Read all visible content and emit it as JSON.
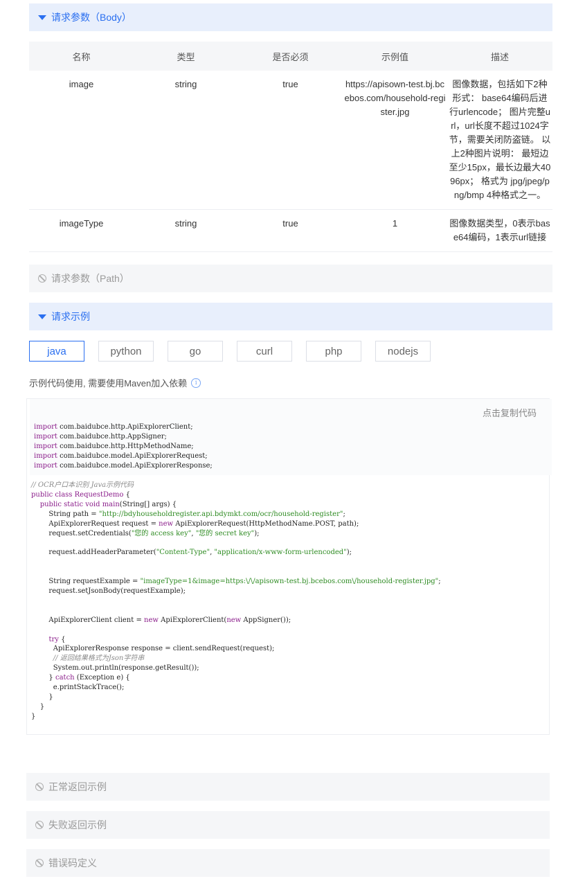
{
  "body_section": {
    "title": "请求参数（Body）"
  },
  "table": {
    "headers": [
      "名称",
      "类型",
      "是否必须",
      "示例值",
      "描述"
    ],
    "rows": [
      {
        "name": "image",
        "type": "string",
        "required": "true",
        "example": "https://apisown-test.bj.bcebos.com/household-register.jpg",
        "desc": "图像数据，包括如下2种形式： base64编码后进行urlencode； 图片完整url，url长度不超过1024字节，需要关闭防盗链。 以上2种图片说明： 最短边至少15px，最长边最大4096px； 格式为 jpg/jpeg/png/bmp 4种格式之一。"
      },
      {
        "name": "imageType",
        "type": "string",
        "required": "true",
        "example": "1",
        "desc": "图像数据类型，0表示base64编码，1表示url链接"
      }
    ]
  },
  "path_section": {
    "title": "请求参数（Path）"
  },
  "example_section": {
    "title": "请求示例"
  },
  "tabs": [
    "java",
    "python",
    "go",
    "curl",
    "php",
    "nodejs"
  ],
  "hint": "示例代码使用, 需要使用Maven加入依赖",
  "copy_label": "点击复制代码",
  "code": {
    "imports": [
      "com.baidubce.http.ApiExplorerClient;",
      "com.baidubce.http.AppSigner;",
      "com.baidubce.http.HttpMethodName;",
      "com.baidubce.model.ApiExplorerRequest;",
      "com.baidubce.model.ApiExplorerResponse;"
    ],
    "comment_title": "// OCR户口本识别 Java示例代码",
    "class_name": "RequestDemo",
    "url": "\"http://bdyhouseholdregister.api.bdymkt.com/ocr/household-register\"",
    "ak": "\"您的 access key\"",
    "sk": "\"您的 secret key\"",
    "header_key": "\"Content-Type\"",
    "header_val": "\"application/x-www-form-urlencoded\"",
    "body_example": "\"imageType=1&image=https:\\/\\/apisown-test.bj.bcebos.com\\/household-register.jpg\"",
    "comment_json": "// 返回结果格式为Json字符串"
  },
  "normal_section": {
    "title": "正常返回示例"
  },
  "fail_section": {
    "title": "失败返回示例"
  },
  "error_section": {
    "title": "错误码定义"
  }
}
